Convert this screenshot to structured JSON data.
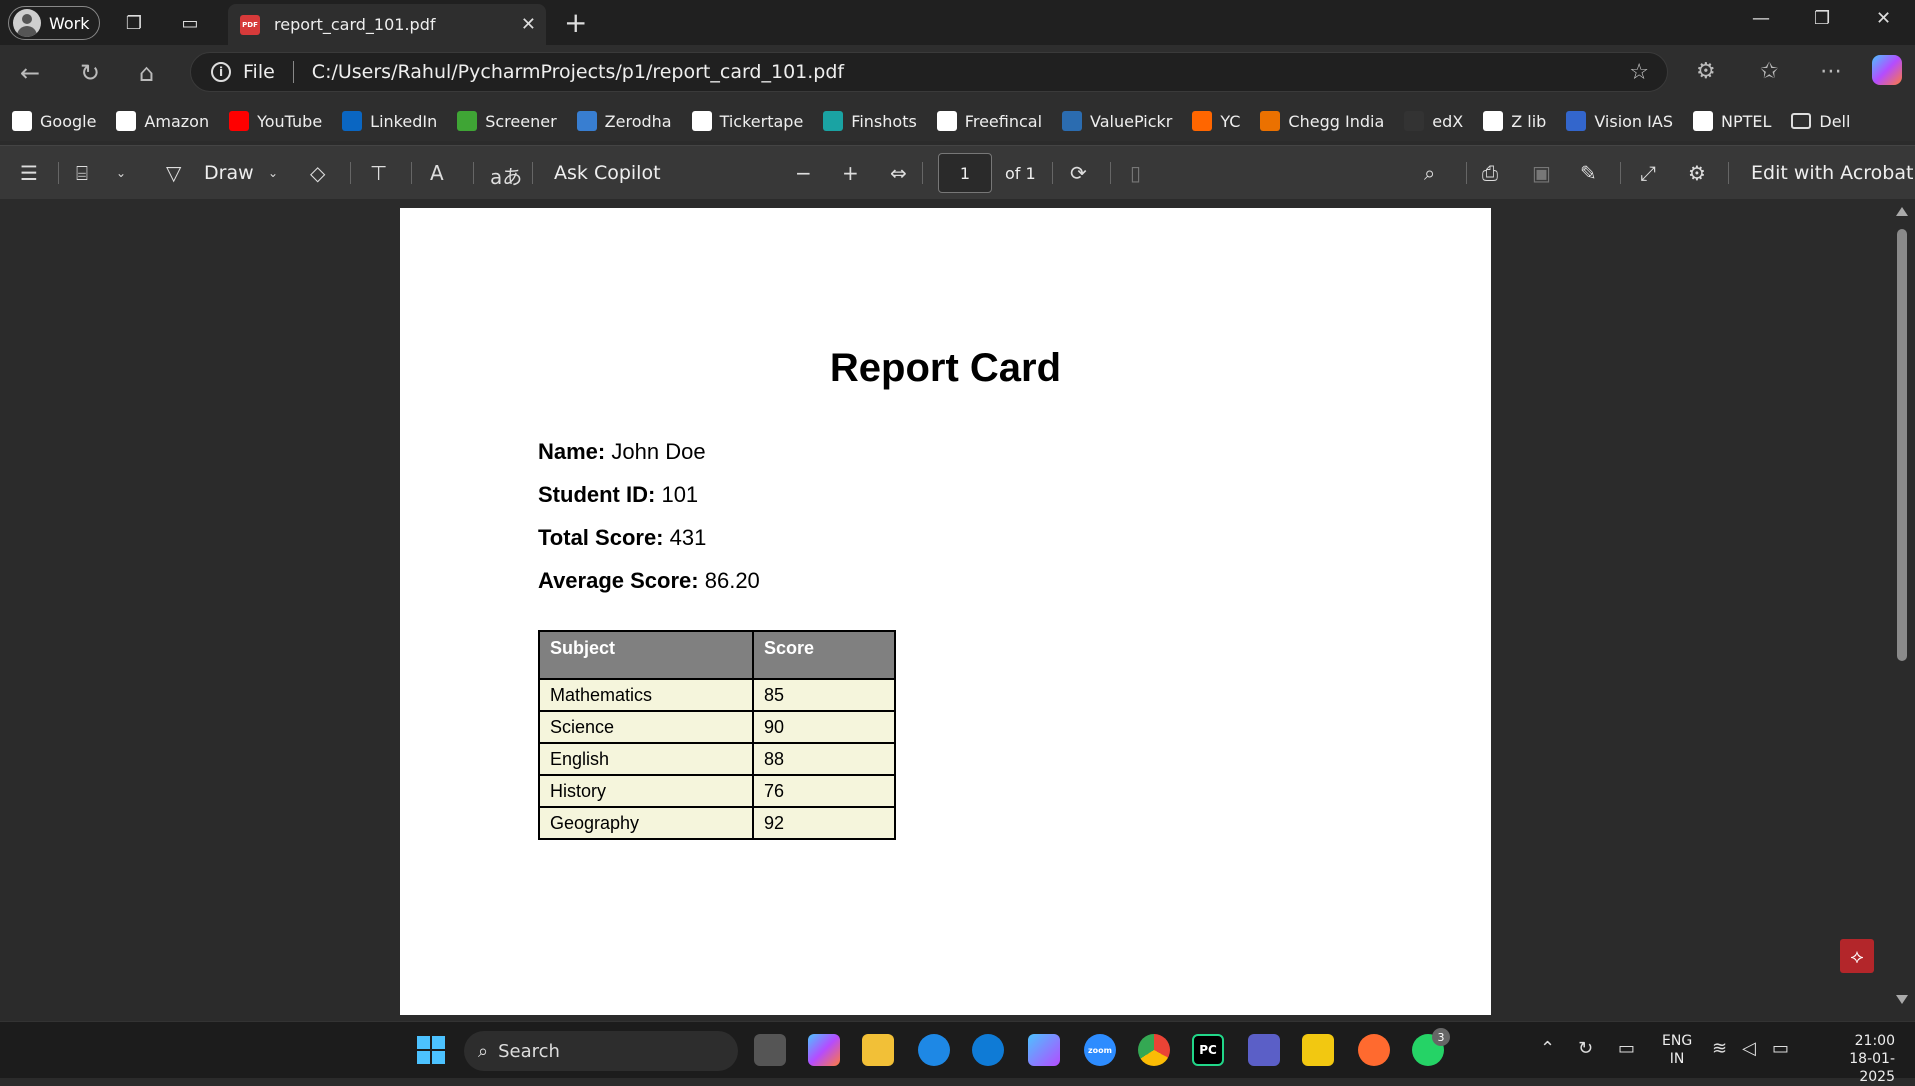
{
  "titlebar": {
    "profile_label": "Work",
    "tab_title": "report_card_101.pdf",
    "pdf_badge": "PDF"
  },
  "addressbar": {
    "scheme_label": "File",
    "url": "C:/Users/Rahul/PycharmProjects/p1/report_card_101.pdf"
  },
  "bookmarks": [
    {
      "label": "Google",
      "icon": "google-icon",
      "color": "#ffffff"
    },
    {
      "label": "Amazon",
      "icon": "amazon-icon",
      "color": "#ffffff"
    },
    {
      "label": "YouTube",
      "icon": "youtube-icon",
      "color": "#ff0000"
    },
    {
      "label": "LinkedIn",
      "icon": "linkedin-icon",
      "color": "#0a66c2"
    },
    {
      "label": "Screener",
      "icon": "screener-icon",
      "color": "#3fa535"
    },
    {
      "label": "Zerodha",
      "icon": "zerodha-icon",
      "color": "#387ed1"
    },
    {
      "label": "Tickertape",
      "icon": "tickertape-icon",
      "color": "#ffffff"
    },
    {
      "label": "Finshots",
      "icon": "finshots-icon",
      "color": "#1aa3a3"
    },
    {
      "label": "Freefincal",
      "icon": "freefincal-icon",
      "color": "#ffffff"
    },
    {
      "label": "ValuePickr",
      "icon": "valuepickr-icon",
      "color": "#2b6cb0"
    },
    {
      "label": "YC",
      "icon": "yc-icon",
      "color": "#ff6600"
    },
    {
      "label": "Chegg India",
      "icon": "chegg-icon",
      "color": "#eb7100"
    },
    {
      "label": "edX",
      "icon": "edx-icon",
      "color": "#333333"
    },
    {
      "label": "Z lib",
      "icon": "zlib-icon",
      "color": "#ffffff"
    },
    {
      "label": "Vision IAS",
      "icon": "visionias-icon",
      "color": "#3366cc"
    },
    {
      "label": "NPTEL",
      "icon": "nptel-icon",
      "color": "#ffffff"
    },
    {
      "label": "Dell",
      "icon": "folder-icon",
      "color": "#2e2e2e"
    }
  ],
  "pdf_toolbar": {
    "draw_label": "Draw",
    "ask_copilot_label": "Ask Copilot",
    "page_number": "1",
    "page_total": "of 1",
    "edit_acrobat_label": "Edit with Acrobat"
  },
  "document": {
    "title": "Report Card",
    "fields": [
      {
        "label": "Name:",
        "value": "John Doe"
      },
      {
        "label": "Student ID:",
        "value": "101"
      },
      {
        "label": "Total Score:",
        "value": "431"
      },
      {
        "label": "Average Score:",
        "value": "86.20"
      }
    ],
    "table": {
      "headers": [
        "Subject",
        "Score"
      ],
      "rows": [
        [
          "Mathematics",
          "85"
        ],
        [
          "Science",
          "90"
        ],
        [
          "English",
          "88"
        ],
        [
          "History",
          "76"
        ],
        [
          "Geography",
          "92"
        ]
      ]
    }
  },
  "taskbar": {
    "search_label": "Search",
    "whatsapp_badge": "3",
    "zoom_label": "zoom",
    "pycharm_label": "PC",
    "lang_top": "ENG",
    "lang_bottom": "IN",
    "time": "21:00",
    "date": "18-01-2025"
  }
}
